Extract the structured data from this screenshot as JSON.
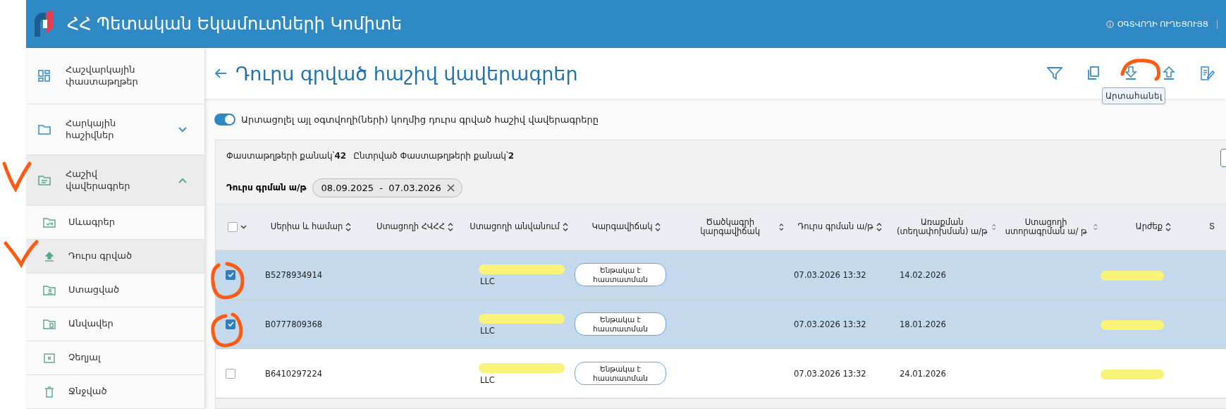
{
  "header": {
    "title": "ՀՀ Պետական Եկամուտների Կոմիտե",
    "guide_link": "ՕԳՏՎՈՂԻ ՈՒՂԵՑՈՒՅՑ"
  },
  "sidebar": {
    "items": [
      {
        "label": "Հաշվարկային փաստաթղթեր",
        "selected": false
      },
      {
        "label": "Հարկային հաշիվներ",
        "selected": false,
        "expanded": false
      },
      {
        "label": "Հաշիվ վավերագրեր",
        "selected": true,
        "expanded": true,
        "children": [
          {
            "label": "Սևագրեր",
            "selected": false
          },
          {
            "label": "Դուրս գրված",
            "selected": true
          },
          {
            "label": "Ստացված",
            "selected": false
          },
          {
            "label": "Անվավեր",
            "selected": false
          },
          {
            "label": "Չեղյալ",
            "selected": false
          },
          {
            "label": "Ջնջված",
            "selected": false
          }
        ]
      }
    ]
  },
  "page": {
    "title": "Դուրս գրված հաշիվ վավերագրեր",
    "tooltip": "Արտահանել"
  },
  "toggle": {
    "label": "Արտացոլել այլ օգտվողի(ների) կողմից դուրս գրված հաշիվ վավերագրերը",
    "on": true
  },
  "summary": [
    "Փաստաթղթերի քանակ՝**42**",
    "Ընտրված Փաստաթղթերի քանակ՝**2**"
  ],
  "date_filter": {
    "label": "Դուրս գրման ա/թ",
    "value": "08.09.2025  -  07.03.2026"
  },
  "table": {
    "select_all": {
      "checked": false
    },
    "columns": [
      "Սերիա և համար",
      "Ստացողի ՀՎՀՀ",
      "Ստացողի անվանում",
      "Կարգավիճակ",
      "Ծածկագրի կարգավիճակ",
      "Դուրս գրման ա/թ",
      "Առաքման (տեղափոխման) ա/թ",
      "Ստացողի ստորագրման ա/ թ",
      "Արժեք",
      "Տ"
    ],
    "rows": [
      {
        "selected": true,
        "series": "B5278934914",
        "name": "LLC",
        "redacted": true,
        "status": "Ենթակա է հաստատման",
        "issue_date": "07.03.2026 13:32",
        "delivery_date": "14.02.2026"
      },
      {
        "selected": true,
        "series": "B0777809368",
        "name": "LLC",
        "redacted": true,
        "status": "Ենթակա է հաստատման",
        "issue_date": "07.03.2026 13:32",
        "delivery_date": "18.01.2026"
      },
      {
        "selected": false,
        "series": "B6410297224",
        "name": "LLC",
        "redacted": true,
        "status": "Ենթակա է հաստատման",
        "issue_date": "07.03.2026 13:32",
        "delivery_date": "24.01.2026"
      }
    ]
  }
}
